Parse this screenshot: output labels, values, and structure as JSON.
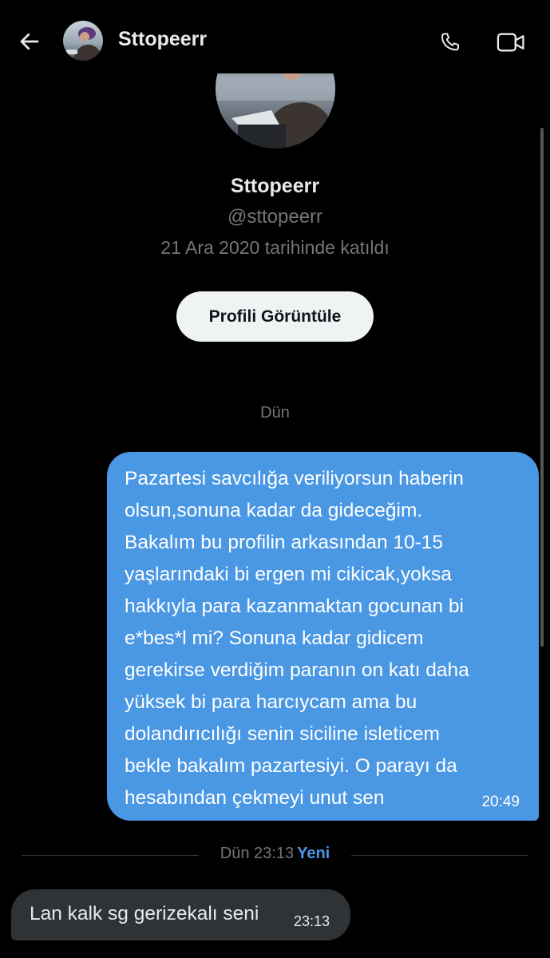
{
  "header": {
    "contact_name": "Sttopeerr",
    "back_icon": "arrow-left-icon",
    "call_icon": "phone-icon",
    "video_icon": "video-camera-icon"
  },
  "profile": {
    "name": "Sttopeerr",
    "handle": "@sttopeerr",
    "joined": "21 Ara 2020 tarihinde katıldı",
    "view_button": "Profili Görüntüle"
  },
  "conversation": {
    "date_label": "Dün",
    "outgoing": {
      "lines": [
        "Pazartesi savcılığa veriliyorsun haberin",
        "olsun,sonuna kadar da gideceğim.",
        "Bakalım bu profilin arkasından 10-15",
        "yaşlarındaki bi ergen mi cikicak,yoksa",
        "hakkıyla para kazanmaktan gocunan bi",
        "e*bes*l mi? Sonuna kadar gidicem",
        "gerekirse verdiğim paranın on katı daha",
        "yüksek bi para harcıycam ama bu",
        "dolandırıcılığı senin siciline isleticem",
        "bekle bakalım pazartesiyi. O parayı da",
        "hesabından çekmeyi unut sen"
      ],
      "time": "20:49"
    },
    "new_separator": {
      "time": "Dün 23:13",
      "label": "Yeni"
    },
    "incoming": {
      "text": "Lan kalk sg gerizekalı seni",
      "time": "23:13"
    }
  },
  "colors": {
    "background": "#000000",
    "outgoing_bubble": "#4a97e4",
    "incoming_bubble": "#2f3336",
    "muted_text": "#71767b",
    "accent": "#4a97e4"
  }
}
